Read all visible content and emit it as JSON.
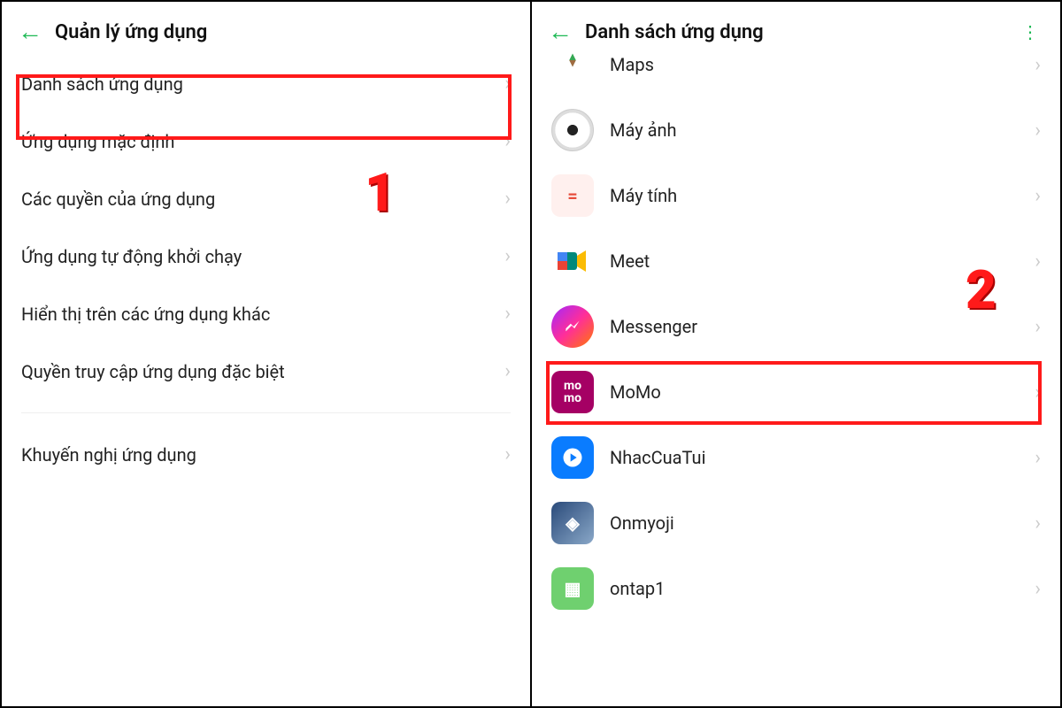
{
  "left": {
    "title": "Quản lý ứng dụng",
    "items": [
      "Danh sách ứng dụng",
      "Ứng dụng mặc định",
      "Các quyền của ứng dụng",
      "Ứng dụng tự động khởi chạy",
      "Hiển thị trên các ứng dụng khác",
      "Quyền truy cập ứng dụng đặc biệt"
    ],
    "footer_item": "Khuyến nghị ứng dụng",
    "step_number": "1"
  },
  "right": {
    "title": "Danh sách ứng dụng",
    "apps": [
      {
        "label": "Maps",
        "icon": "maps"
      },
      {
        "label": "Máy ảnh",
        "icon": "camera"
      },
      {
        "label": "Máy tính",
        "icon": "calc"
      },
      {
        "label": "Meet",
        "icon": "meet"
      },
      {
        "label": "Messenger",
        "icon": "messenger"
      },
      {
        "label": "MoMo",
        "icon": "momo"
      },
      {
        "label": "NhacCuaTui",
        "icon": "nct"
      },
      {
        "label": "Onmyoji",
        "icon": "onmyoji"
      },
      {
        "label": "ontap1",
        "icon": "ontap"
      }
    ],
    "step_number": "2"
  }
}
